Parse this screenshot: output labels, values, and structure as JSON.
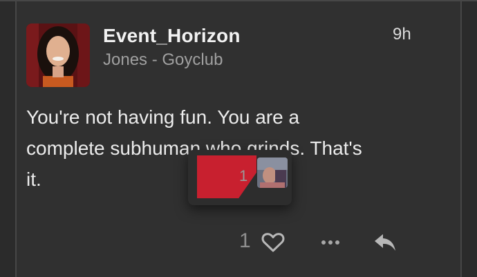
{
  "post": {
    "username": "Event_Horizon",
    "subtitle": "Jones - Goyclub",
    "time": "9h",
    "text_lines": [
      "You're not having fun. You are a",
      "complete subhuman who grinds. That's",
      "it."
    ]
  },
  "popup": {
    "count": "1"
  },
  "actions": {
    "like_count": "1",
    "icons": [
      "heart-icon",
      "more-icon",
      "reply-icon"
    ]
  },
  "colors": {
    "background": "#303030",
    "accent_red": "#c8202f",
    "muted_text": "#a0a0a0"
  }
}
